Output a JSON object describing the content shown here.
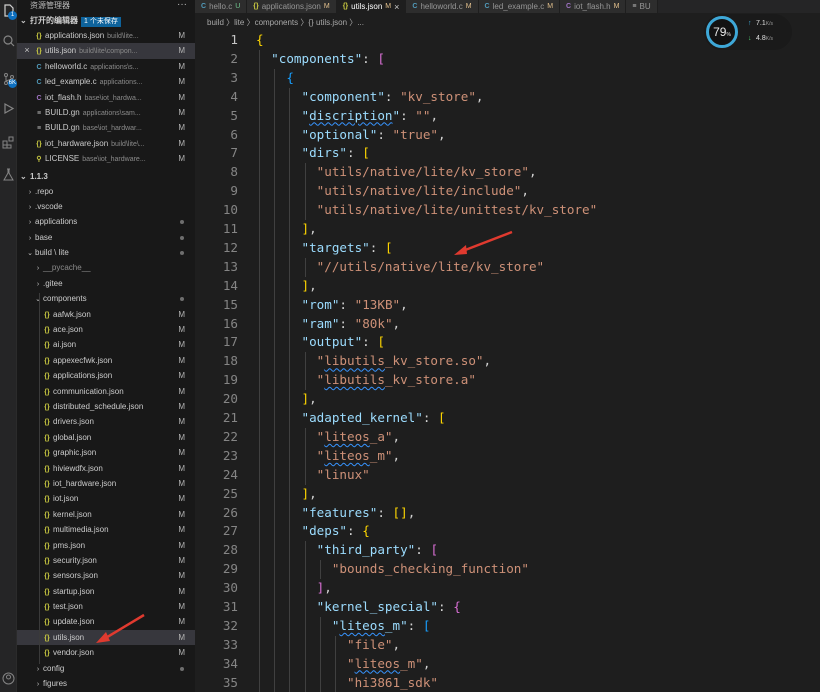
{
  "activity": {
    "explorer_badge": "1",
    "ext_badge": "6K"
  },
  "sidebar": {
    "title": "资源管理器",
    "more": "···",
    "open_editors": {
      "label": "打开的编辑器",
      "badge": "1 个未保存",
      "items": [
        {
          "name": "applications.json",
          "path": "build\\lite...",
          "status": "M",
          "type": "json",
          "closable": false
        },
        {
          "name": "utils.json",
          "path": "build\\lite\\compon...",
          "status": "M",
          "type": "json",
          "closable": true,
          "active": true
        },
        {
          "name": "helloworld.c",
          "path": "applications\\s...",
          "status": "M",
          "type": "c"
        },
        {
          "name": "led_example.c",
          "path": "applications...",
          "status": "M",
          "type": "c"
        },
        {
          "name": "iot_flash.h",
          "path": "base\\iot_hardwa...",
          "status": "M",
          "type": "h"
        },
        {
          "name": "BUILD.gn",
          "path": "applications\\sam...",
          "status": "M",
          "type": "gn"
        },
        {
          "name": "BUILD.gn",
          "path": "base\\iot_hardwar...",
          "status": "M",
          "type": "gn"
        },
        {
          "name": "iot_hardware.json",
          "path": "build\\lite\\...",
          "status": "M",
          "type": "json"
        },
        {
          "name": "LICENSE",
          "path": "base\\iot_hardware...",
          "status": "M",
          "type": "lic"
        }
      ]
    },
    "workspace": {
      "label": "1.1.3",
      "tree": [
        {
          "name": ".repo",
          "kind": "folder",
          "indent": 0,
          "open": false,
          "mark": ""
        },
        {
          "name": ".vscode",
          "kind": "folder",
          "indent": 0,
          "open": false,
          "mark": ""
        },
        {
          "name": "applications",
          "kind": "folder",
          "indent": 0,
          "open": false,
          "mark": "dot"
        },
        {
          "name": "base",
          "kind": "folder",
          "indent": 0,
          "open": false,
          "mark": "dot"
        },
        {
          "name": "build \\ lite",
          "kind": "folder",
          "indent": 0,
          "open": true,
          "mark": "dot"
        },
        {
          "name": "__pycache__",
          "kind": "folder",
          "indent": 1,
          "open": false,
          "mark": "",
          "dim": true
        },
        {
          "name": ".gitee",
          "kind": "folder",
          "indent": 1,
          "open": false,
          "mark": ""
        },
        {
          "name": "components",
          "kind": "folder",
          "indent": 1,
          "open": true,
          "mark": "dot"
        },
        {
          "name": "aafwk.json",
          "kind": "json",
          "indent": 2,
          "mark": "M"
        },
        {
          "name": "ace.json",
          "kind": "json",
          "indent": 2,
          "mark": "M"
        },
        {
          "name": "ai.json",
          "kind": "json",
          "indent": 2,
          "mark": "M"
        },
        {
          "name": "appexecfwk.json",
          "kind": "json",
          "indent": 2,
          "mark": "M"
        },
        {
          "name": "applications.json",
          "kind": "json",
          "indent": 2,
          "mark": "M"
        },
        {
          "name": "communication.json",
          "kind": "json",
          "indent": 2,
          "mark": "M"
        },
        {
          "name": "distributed_schedule.json",
          "kind": "json",
          "indent": 2,
          "mark": "M"
        },
        {
          "name": "drivers.json",
          "kind": "json",
          "indent": 2,
          "mark": "M"
        },
        {
          "name": "global.json",
          "kind": "json",
          "indent": 2,
          "mark": "M"
        },
        {
          "name": "graphic.json",
          "kind": "json",
          "indent": 2,
          "mark": "M"
        },
        {
          "name": "hiviewdfx.json",
          "kind": "json",
          "indent": 2,
          "mark": "M"
        },
        {
          "name": "iot_hardware.json",
          "kind": "json",
          "indent": 2,
          "mark": "M"
        },
        {
          "name": "iot.json",
          "kind": "json",
          "indent": 2,
          "mark": "M"
        },
        {
          "name": "kernel.json",
          "kind": "json",
          "indent": 2,
          "mark": "M"
        },
        {
          "name": "multimedia.json",
          "kind": "json",
          "indent": 2,
          "mark": "M"
        },
        {
          "name": "pms.json",
          "kind": "json",
          "indent": 2,
          "mark": "M"
        },
        {
          "name": "security.json",
          "kind": "json",
          "indent": 2,
          "mark": "M"
        },
        {
          "name": "sensors.json",
          "kind": "json",
          "indent": 2,
          "mark": "M"
        },
        {
          "name": "startup.json",
          "kind": "json",
          "indent": 2,
          "mark": "M"
        },
        {
          "name": "test.json",
          "kind": "json",
          "indent": 2,
          "mark": "M"
        },
        {
          "name": "update.json",
          "kind": "json",
          "indent": 2,
          "mark": "M"
        },
        {
          "name": "utils.json",
          "kind": "json",
          "indent": 2,
          "mark": "M",
          "active": true
        },
        {
          "name": "vendor.json",
          "kind": "json",
          "indent": 2,
          "mark": "M"
        },
        {
          "name": "config",
          "kind": "folder",
          "indent": 1,
          "open": false,
          "mark": "dot"
        },
        {
          "name": "figures",
          "kind": "folder",
          "indent": 1,
          "open": false,
          "mark": ""
        }
      ]
    }
  },
  "tabs": [
    {
      "name": "hello.c",
      "status": "U",
      "type": "c"
    },
    {
      "name": "applications.json",
      "status": "M",
      "type": "json"
    },
    {
      "name": "utils.json",
      "status": "M",
      "type": "json",
      "active": true
    },
    {
      "name": "helloworld.c",
      "status": "M",
      "type": "c"
    },
    {
      "name": "led_example.c",
      "status": "M",
      "type": "c"
    },
    {
      "name": "iot_flash.h",
      "status": "M",
      "type": "h"
    },
    {
      "name": "BU",
      "status": "",
      "type": "gn"
    }
  ],
  "breadcrumb": "build 〉lite 〉components 〉{} utils.json 〉...",
  "perf": {
    "percent": "79",
    "unit": "%",
    "up": "7.1",
    "down": "4.8",
    "rate_unit": "K/s"
  },
  "editor": {
    "lines": [
      "{",
      "  \"components\": [",
      "    {",
      "      \"component\": \"kv_store\",",
      "      \"discription\": \"\",",
      "      \"optional\": \"true\",",
      "      \"dirs\": [",
      "        \"utils/native/lite/kv_store\",",
      "        \"utils/native/lite/include\",",
      "        \"utils/native/lite/unittest/kv_store\"",
      "      ],",
      "      \"targets\": [",
      "        \"//utils/native/lite/kv_store\"",
      "      ],",
      "      \"rom\": \"13KB\",",
      "      \"ram\": \"80k\",",
      "      \"output\": [",
      "        \"libutils_kv_store.so\",",
      "        \"libutils_kv_store.a\"",
      "      ],",
      "      \"adapted_kernel\": [",
      "        \"liteos_a\",",
      "        \"liteos_m\",",
      "        \"linux\"",
      "      ],",
      "      \"features\": [],",
      "      \"deps\": {",
      "        \"third_party\": [",
      "          \"bounds_checking_function\"",
      "        ],",
      "        \"kernel_special\": {",
      "          \"liteos_m\": [",
      "            \"file\",",
      "            \"liteos_m\",",
      "            \"hi3861_sdk\""
    ]
  }
}
